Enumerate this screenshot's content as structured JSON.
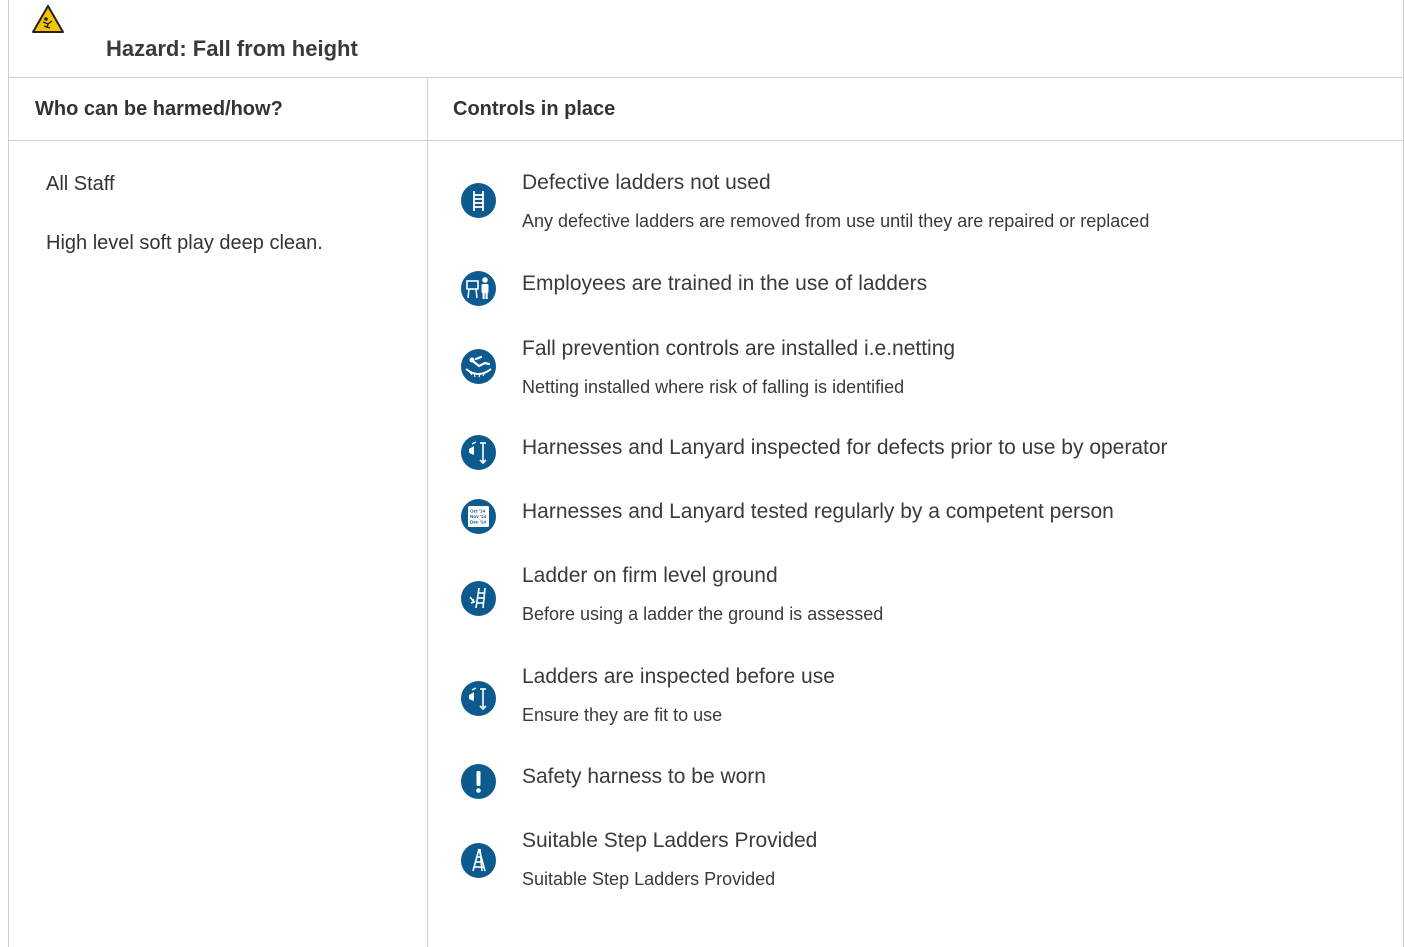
{
  "hazard": {
    "title": "Hazard:  Fall from height",
    "icon": "hazard-warning-triangle-icon",
    "icon_colors": {
      "fill": "#f5c400",
      "outline": "#222222"
    }
  },
  "columns": {
    "who_label": "Who can be harmed/how?",
    "controls_label": "Controls in place"
  },
  "who": [
    "All Staff",
    "High level soft play deep clean."
  ],
  "controls": [
    {
      "icon": "ladder-icon",
      "title": "Defective ladders not used",
      "description": "Any defective ladders are removed from use until they are repaired or replaced"
    },
    {
      "icon": "training-icon",
      "title": "Employees are trained in the use of ladders",
      "description": ""
    },
    {
      "icon": "fall-netting-icon",
      "title": "Fall prevention controls are installed i.e.netting",
      "description": "Netting installed where risk of falling is identified"
    },
    {
      "icon": "inspection-icon",
      "title": "Harnesses and Lanyard inspected for defects prior to use by operator",
      "description": ""
    },
    {
      "icon": "calendar-test-icon",
      "title": "Harnesses and Lanyard tested regularly by a competent person",
      "description": ""
    },
    {
      "icon": "ladder-ground-icon",
      "title": "Ladder on firm level ground",
      "description": "Before using a ladder the ground is assessed"
    },
    {
      "icon": "inspection-icon",
      "title": "Ladders are inspected before use",
      "description": "Ensure they are fit to use"
    },
    {
      "icon": "exclamation-icon",
      "title": "Safety harness to be worn",
      "description": ""
    },
    {
      "icon": "step-ladder-icon",
      "title": "Suitable Step Ladders Provided",
      "description": "Suitable Step Ladders Provided"
    }
  ],
  "calendar_icon_text": [
    "Oct '14",
    "Nov '14",
    "Dec '14"
  ],
  "colors": {
    "icon_bg": "#0d5a8f",
    "border": "#cfcfcf",
    "text": "#333333"
  }
}
